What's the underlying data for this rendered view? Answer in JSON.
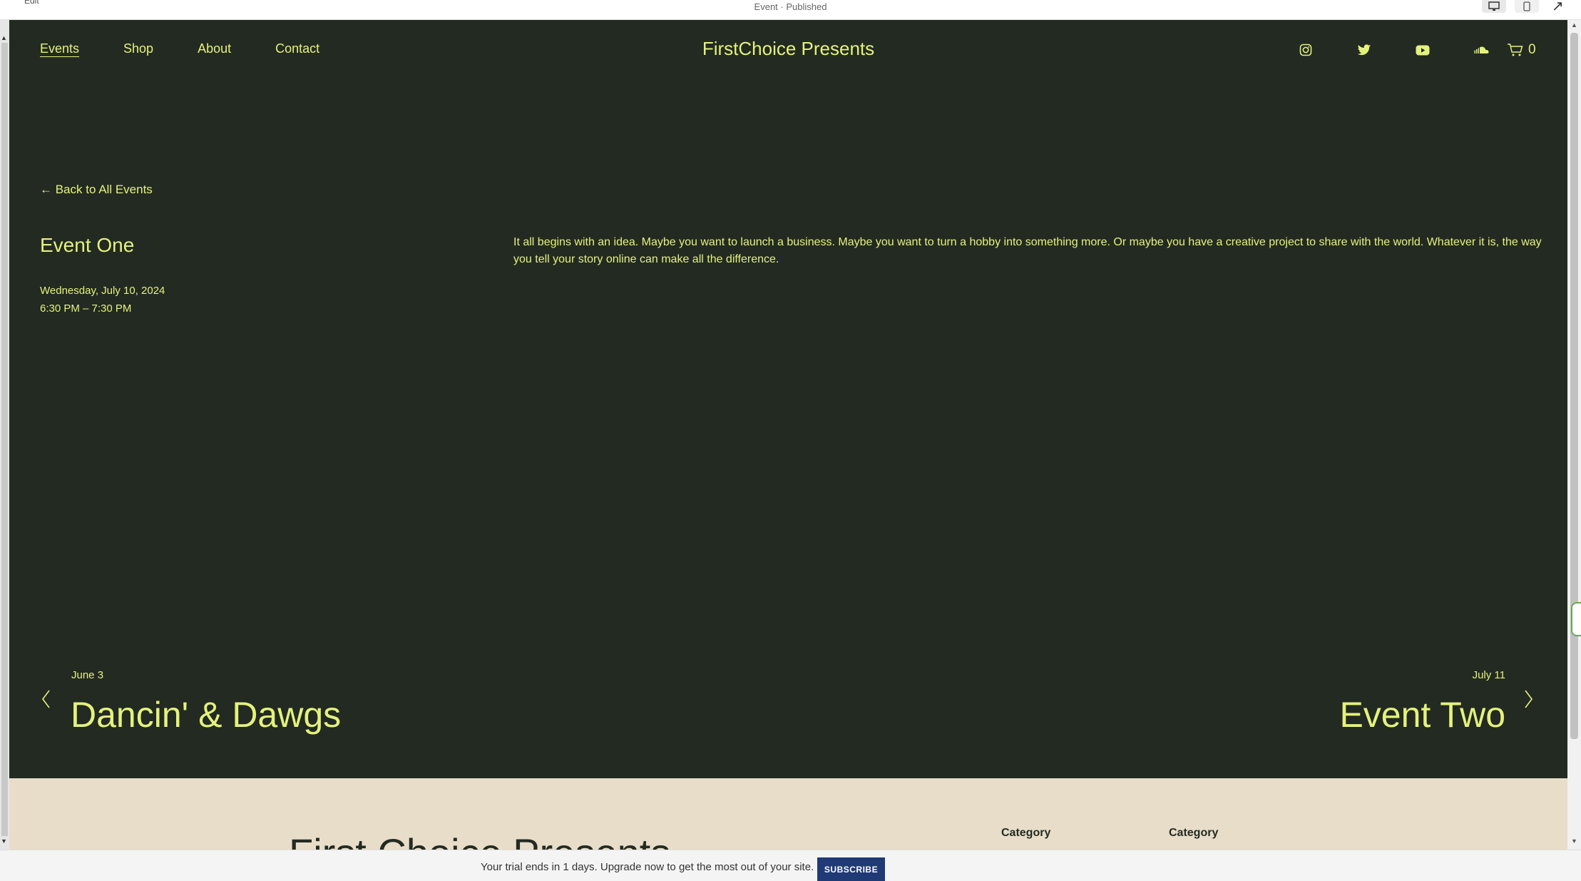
{
  "editor": {
    "edit_label": "Edit",
    "status": "Event · Published"
  },
  "colors": {
    "background": "#232a22",
    "accent": "#e4f27c",
    "footer": "#e8ddc9",
    "subscribe": "#1f3a75"
  },
  "nav": {
    "items": [
      {
        "label": "Events",
        "active": true
      },
      {
        "label": "Shop"
      },
      {
        "label": "About"
      },
      {
        "label": "Contact"
      }
    ]
  },
  "brand": "FirstChoice Presents",
  "socials": [
    "instagram-icon",
    "twitter-icon",
    "youtube-icon",
    "soundcloud-icon"
  ],
  "cart": {
    "count": "0"
  },
  "event": {
    "back_label": "← Back to All Events",
    "title": "Event One",
    "date": "Wednesday, July 10, 2024",
    "time": "6:30 PM – 7:30 PM",
    "description": "It all begins with an idea. Maybe you want to launch a business. Maybe you want to turn a hobby into something more. Or maybe you have a creative project to share with the world. Whatever it is, the way you tell your story online can make all the difference."
  },
  "pager": {
    "prev": {
      "date": "June 3",
      "title": "Dancin' & Dawgs"
    },
    "next": {
      "date": "July 11",
      "title": "Event Two"
    }
  },
  "footer": {
    "brand": "First Choice Presents",
    "category_1": "Category",
    "category_2": "Category"
  },
  "trial": {
    "message": "Your trial ends in 1 days. Upgrade now to get the most out of your site.",
    "subscribe_label": "SUBSCRIBE"
  }
}
